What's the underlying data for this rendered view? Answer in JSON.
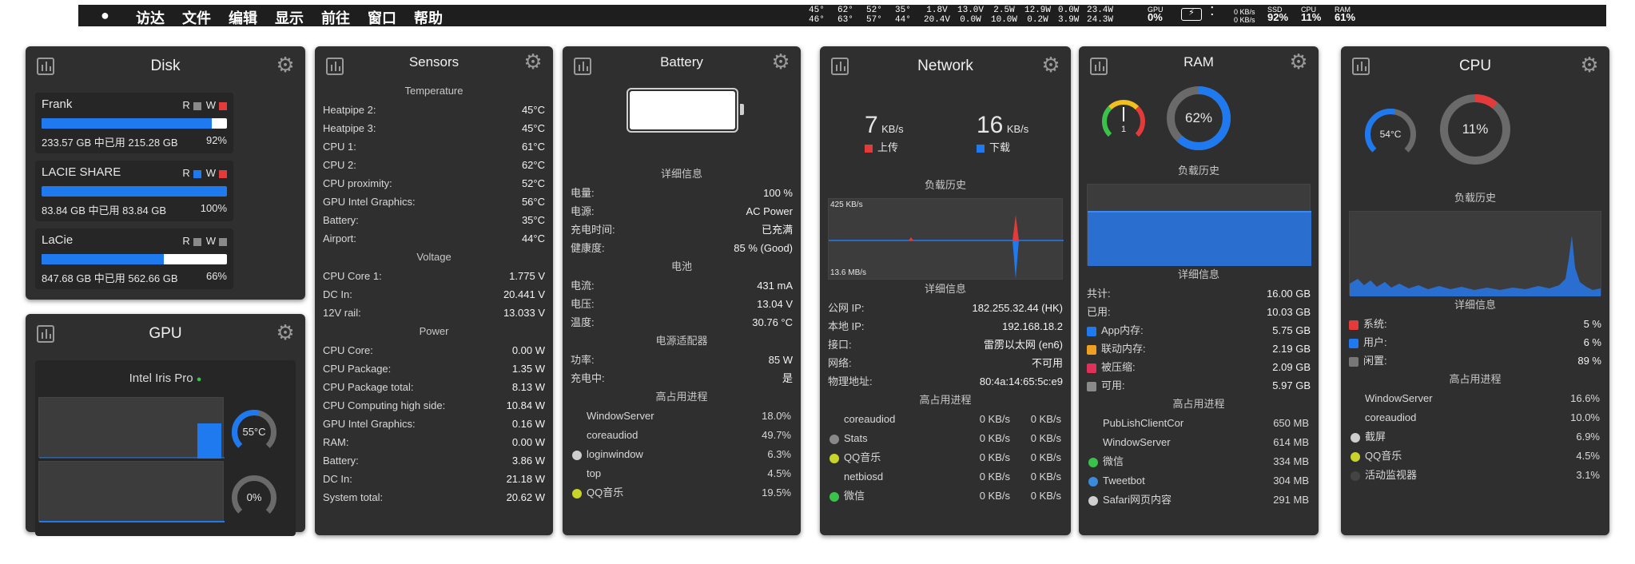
{
  "menubar": {
    "apple": "",
    "menus": [
      "访达",
      "文件",
      "编辑",
      "显示",
      "前往",
      "窗口",
      "帮助"
    ],
    "temps": [
      [
        "45°",
        "46°"
      ],
      [
        "62°",
        "63°"
      ],
      [
        "52°",
        "57°"
      ],
      [
        "35°",
        "44°"
      ]
    ],
    "volts": [
      [
        "1.8V",
        "20.4V"
      ],
      [
        "13.0V",
        "0.0W"
      ],
      [
        "2.5W",
        "10.0W"
      ],
      [
        "12.9W",
        "0.2W"
      ],
      [
        "0.0W",
        "3.9W"
      ],
      [
        "23.4W",
        "24.3W"
      ]
    ],
    "gpu_label": "GPU",
    "gpu_value": "0%",
    "net": [
      "0 KB/s",
      "0 KB/s"
    ],
    "ssd_label": "SSD",
    "ssd_value": "92%",
    "cpu_label": "CPU",
    "cpu_value": "11%",
    "ram_label": "RAM",
    "ram_value": "61%"
  },
  "disk": {
    "title": "Disk",
    "disks": [
      {
        "name": "Frank",
        "r": "R",
        "w": "W",
        "size": "233.57 GB 中已用 215.28 GB",
        "pct": "92%",
        "fill": 0.92,
        "r_color": "#8a8a8a",
        "w_color": "#e33a3a"
      },
      {
        "name": "LACIE SHARE",
        "r": "R",
        "w": "W",
        "size": "83.84 GB 中已用 83.84 GB",
        "pct": "100%",
        "fill": 1.0,
        "r_color": "#1f7af0",
        "w_color": "#e33a3a"
      },
      {
        "name": "LaCie",
        "r": "R",
        "w": "W",
        "size": "847.68 GB 中已用 562.66 GB",
        "pct": "66%",
        "fill": 0.66,
        "r_color": "#8a8a8a",
        "w_color": "#8a8a8a"
      }
    ]
  },
  "gpu": {
    "title": "GPU",
    "model": "Intel Iris Pro",
    "temp": "55°C",
    "usage": "0%",
    "temp_level": 0.55,
    "usage_level": 0.0
  },
  "sensors": {
    "title": "Sensors",
    "temperature": {
      "label": "Temperature",
      "rows": [
        [
          "Heatpipe 2:",
          "45°C"
        ],
        [
          "Heatpipe 3:",
          "45°C"
        ],
        [
          "CPU 1:",
          "61°C"
        ],
        [
          "CPU 2:",
          "62°C"
        ],
        [
          "CPU proximity:",
          "52°C"
        ],
        [
          "GPU Intel Graphics:",
          "56°C"
        ],
        [
          "Battery:",
          "35°C"
        ],
        [
          "Airport:",
          "44°C"
        ]
      ]
    },
    "voltage": {
      "label": "Voltage",
      "rows": [
        [
          "CPU Core 1:",
          "1.775 V"
        ],
        [
          "DC In:",
          "20.441 V"
        ],
        [
          "12V rail:",
          "13.033 V"
        ]
      ]
    },
    "power": {
      "label": "Power",
      "rows": [
        [
          "CPU Core:",
          "0.00 W"
        ],
        [
          "CPU Package:",
          "1.35 W"
        ],
        [
          "CPU Package total:",
          "8.13 W"
        ],
        [
          "CPU Computing high side:",
          "10.84 W"
        ],
        [
          "GPU Intel Graphics:",
          "0.16 W"
        ],
        [
          "RAM:",
          "0.00 W"
        ],
        [
          "Battery:",
          "3.86 W"
        ],
        [
          "DC In:",
          "21.18 W"
        ],
        [
          "System total:",
          "20.62 W"
        ]
      ]
    }
  },
  "battery": {
    "title": "Battery",
    "charge_level": 1.0,
    "details_label": "详细信息",
    "details": [
      [
        "电量:",
        "100 %"
      ],
      [
        "电源:",
        "AC Power"
      ],
      [
        "充电时间:",
        "已充满"
      ],
      [
        "健康度:",
        "85 % (Good)"
      ]
    ],
    "battery_label": "电池",
    "battery_rows": [
      [
        "电流:",
        "431 mA"
      ],
      [
        "电压:",
        "13.04 V"
      ],
      [
        "温度:",
        "30.76 °C"
      ]
    ],
    "adapter_label": "电源适配器",
    "adapter_rows": [
      [
        "功率:",
        "85 W"
      ],
      [
        "充电中:",
        "是"
      ]
    ],
    "proc_label": "高占用进程",
    "procs": [
      [
        "WindowServer",
        "18.0%",
        ""
      ],
      [
        "coreaudiod",
        "49.7%",
        ""
      ],
      [
        "loginwindow",
        "6.3%",
        "#cfcfcf"
      ],
      [
        "top",
        "4.5%",
        ""
      ],
      [
        "QQ音乐",
        "19.5%",
        "#c8d42a"
      ]
    ]
  },
  "network": {
    "title": "Network",
    "upload": "7",
    "upload_unit": "KB/s",
    "upload_label": "上传",
    "download": "16",
    "download_unit": "KB/s",
    "download_label": "下载",
    "upload_color": "#e33a3a",
    "download_color": "#1f7af0",
    "history_label": "负载历史",
    "graph_top": "425 KB/s",
    "graph_bottom": "13.6 MB/s",
    "details_label": "详细信息",
    "details": [
      [
        "公网 IP:",
        "182.255.32.44 (HK)"
      ],
      [
        "本地 IP:",
        "192.168.18.2"
      ],
      [
        "接口:",
        "雷雳以太网 (en6)"
      ],
      [
        "网络:",
        "不可用"
      ],
      [
        "物理地址:",
        "80:4a:14:65:5c:e9"
      ]
    ],
    "proc_label": "高占用进程",
    "procs": [
      [
        "coreaudiod",
        "0 KB/s",
        "0 KB/s",
        ""
      ],
      [
        "Stats",
        "0 KB/s",
        "0 KB/s",
        "#888"
      ],
      [
        "QQ音乐",
        "0 KB/s",
        "0 KB/s",
        "#c8d42a"
      ],
      [
        "netbiosd",
        "0 KB/s",
        "0 KB/s",
        ""
      ],
      [
        "微信",
        "0 KB/s",
        "0 KB/s",
        "#3ac34a"
      ]
    ]
  },
  "ram": {
    "title": "RAM",
    "pressure": "1",
    "usage": "62%",
    "usage_level": 0.62,
    "history_label": "负载历史",
    "details_label": "详细信息",
    "details": [
      [
        "共计:",
        "16.00 GB",
        ""
      ],
      [
        "已用:",
        "10.03 GB",
        ""
      ],
      [
        "App内存:",
        "5.75 GB",
        "#1f7af0"
      ],
      [
        "联动内存:",
        "2.19 GB",
        "#f0a020"
      ],
      [
        "被压缩:",
        "2.09 GB",
        "#e0305a"
      ],
      [
        "可用:",
        "5.97 GB",
        "#8a8a8a"
      ]
    ],
    "proc_label": "高占用进程",
    "procs": [
      [
        "PubLishClientCor",
        "650 MB",
        ""
      ],
      [
        "WindowServer",
        "614 MB",
        ""
      ],
      [
        "微信",
        "334 MB",
        "#3ac34a"
      ],
      [
        "Tweetbot",
        "304 MB",
        "#3a8ae0"
      ],
      [
        "Safari网页内容",
        "291 MB",
        "#cfcfcf"
      ]
    ]
  },
  "cpu": {
    "title": "CPU",
    "temp": "54°C",
    "temp_level": 0.54,
    "usage": "11%",
    "usage_level": 0.11,
    "history_label": "负载历史",
    "details_label": "详细信息",
    "details": [
      [
        "系统:",
        "5 %",
        "#e33a3a"
      ],
      [
        "用户:",
        "6 %",
        "#1f7af0"
      ],
      [
        "闲置:",
        "89 %",
        "#777777"
      ]
    ],
    "proc_label": "高占用进程",
    "procs": [
      [
        "WindowServer",
        "16.6%",
        ""
      ],
      [
        "coreaudiod",
        "10.0%",
        ""
      ],
      [
        "截屏",
        "6.9%",
        "#cfcfcf"
      ],
      [
        "QQ音乐",
        "4.5%",
        "#c8d42a"
      ],
      [
        "活动监视器",
        "3.1%",
        "#444"
      ]
    ]
  }
}
